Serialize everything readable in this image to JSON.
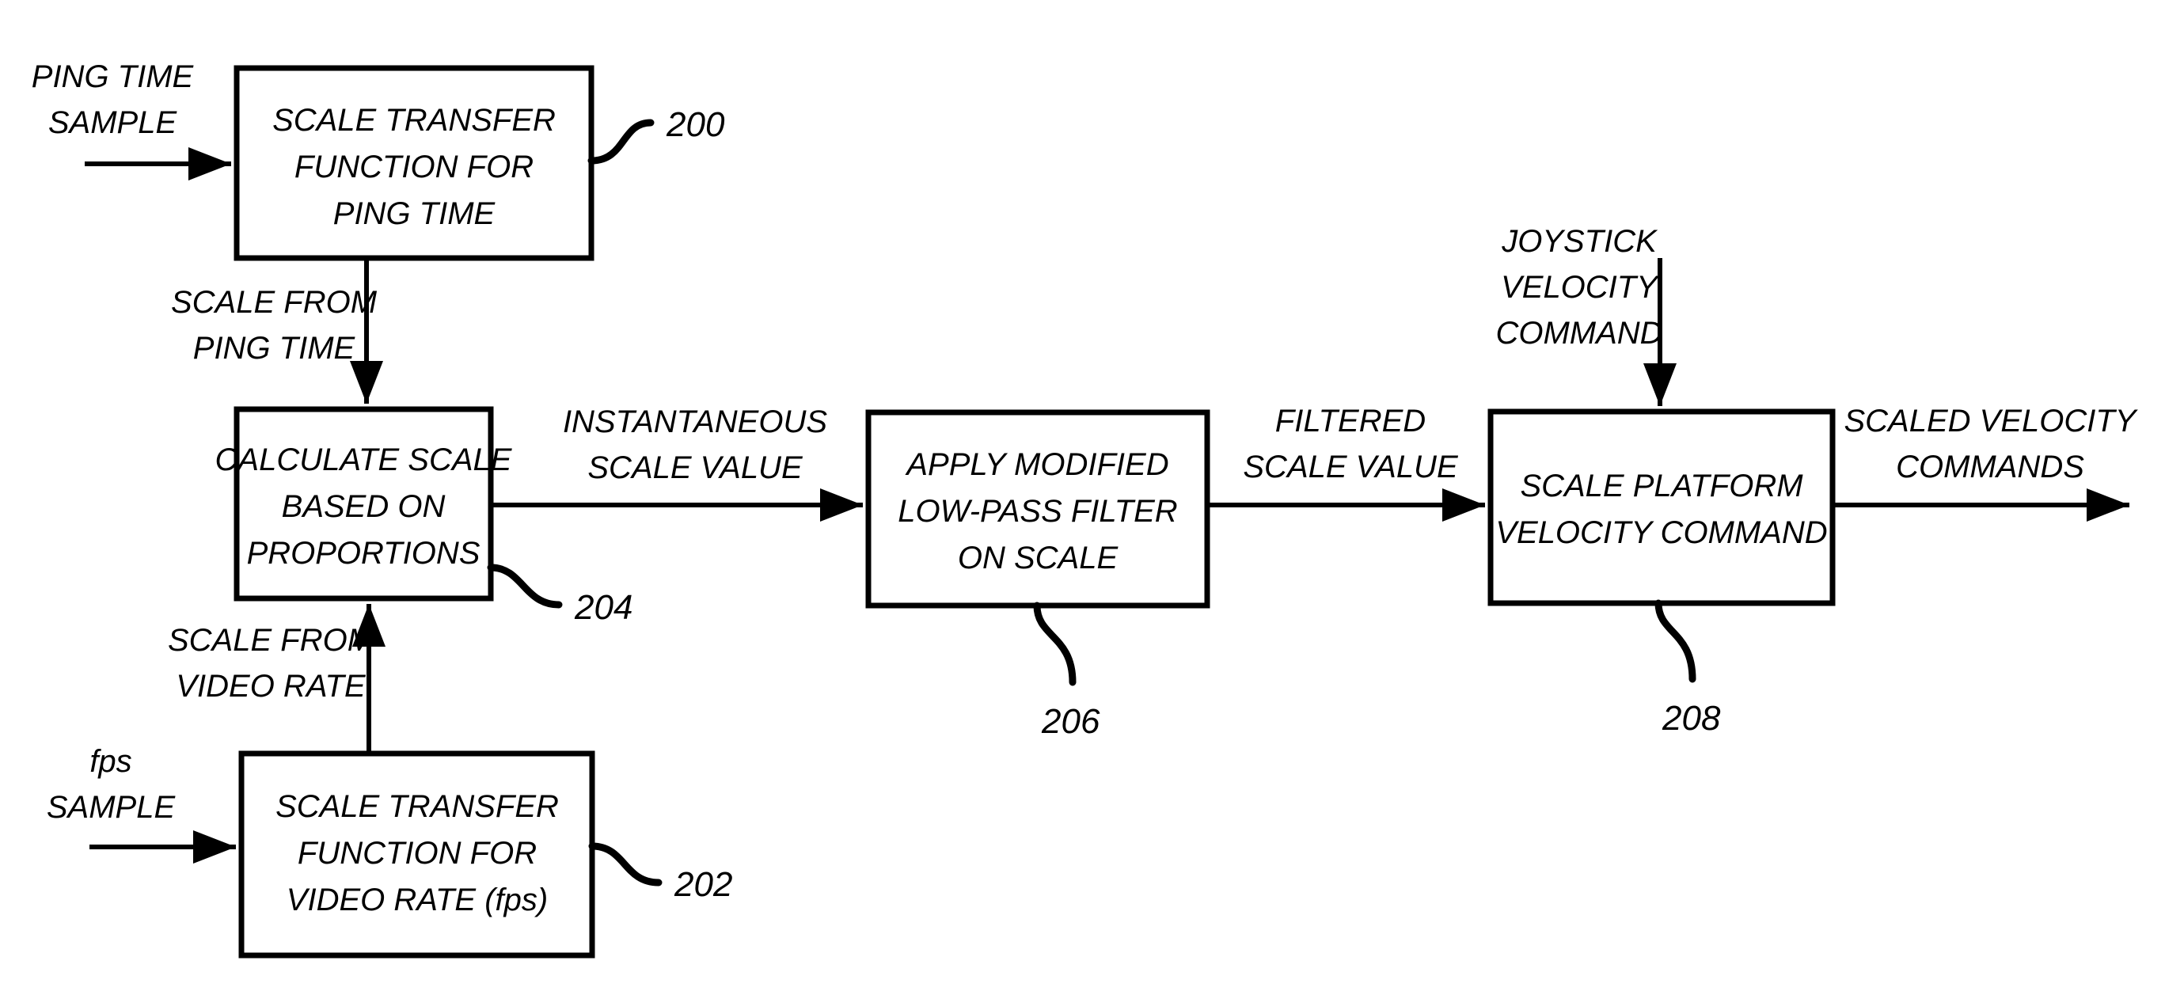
{
  "figure": {
    "type": "patent-block-diagram",
    "background_color": "#ffffff",
    "line_color": "#000000"
  },
  "blocks": [
    {
      "ref": "200",
      "lines": [
        "SCALE TRANSFER",
        "FUNCTION FOR",
        "PING TIME"
      ]
    },
    {
      "ref": "202",
      "lines": [
        "SCALE TRANSFER",
        "FUNCTION FOR",
        "VIDEO RATE (fps)"
      ]
    },
    {
      "ref": "204",
      "lines": [
        "CALCULATE SCALE",
        "BASED ON",
        "PROPORTIONS"
      ]
    },
    {
      "ref": "206",
      "lines": [
        "APPLY MODIFIED",
        "LOW-PASS FILTER",
        "ON SCALE"
      ]
    },
    {
      "ref": "208",
      "lines": [
        "SCALE PLATFORM",
        "VELOCITY COMMAND"
      ]
    }
  ],
  "inputs": [
    {
      "id": "ping-time-sample",
      "lines": [
        "PING TIME",
        "SAMPLE"
      ]
    },
    {
      "id": "fps-sample",
      "lines": [
        "fps",
        "SAMPLE"
      ]
    },
    {
      "id": "joystick-velocity-command",
      "lines": [
        "JOYSTICK",
        "VELOCITY",
        "COMMAND"
      ]
    }
  ],
  "outputs": [
    {
      "id": "scaled-velocity-commands",
      "lines": [
        "SCALED VELOCITY",
        "COMMANDS"
      ]
    }
  ],
  "edge_labels": [
    {
      "id": "scale-from-ping-time",
      "lines": [
        "SCALE FROM",
        "PING TIME"
      ]
    },
    {
      "id": "scale-from-video-rate",
      "lines": [
        "SCALE FROM",
        "VIDEO RATE"
      ]
    },
    {
      "id": "instantaneous-scale-value",
      "lines": [
        "INSTANTANEOUS",
        "SCALE VALUE"
      ]
    },
    {
      "id": "filtered-scale-value",
      "lines": [
        "FILTERED",
        "SCALE VALUE"
      ]
    }
  ],
  "reference_numerals": {
    "block_200": "200",
    "block_202": "202",
    "block_204": "204",
    "block_206": "206",
    "block_208": "208"
  },
  "text": {
    "b200_l1": "SCALE TRANSFER",
    "b200_l2": "FUNCTION FOR",
    "b200_l3": "PING TIME",
    "b202_l1": "SCALE TRANSFER",
    "b202_l2": "FUNCTION FOR",
    "b202_l3": "VIDEO RATE (fps)",
    "b204_l1": "CALCULATE SCALE",
    "b204_l2": "BASED ON",
    "b204_l3": "PROPORTIONS",
    "b206_l1": "APPLY MODIFIED",
    "b206_l2": "LOW-PASS FILTER",
    "b206_l3": "ON SCALE",
    "b208_l1": "SCALE PLATFORM",
    "b208_l2": "VELOCITY COMMAND",
    "in_ping_l1": "PING TIME",
    "in_ping_l2": "SAMPLE",
    "in_fps_l1": "fps",
    "in_fps_l2": "SAMPLE",
    "in_joy_l1": "JOYSTICK",
    "in_joy_l2": "VELOCITY",
    "in_joy_l3": "COMMAND",
    "out_l1": "SCALED VELOCITY",
    "out_l2": "COMMANDS",
    "e_sfpt_l1": "SCALE FROM",
    "e_sfpt_l2": "PING TIME",
    "e_sfvr_l1": "SCALE FROM",
    "e_sfvr_l2": "VIDEO RATE",
    "e_isv_l1": "INSTANTANEOUS",
    "e_isv_l2": "SCALE VALUE",
    "e_fsv_l1": "FILTERED",
    "e_fsv_l2": "SCALE VALUE",
    "ref200": "200",
    "ref202": "202",
    "ref204": "204",
    "ref206": "206",
    "ref208": "208"
  }
}
